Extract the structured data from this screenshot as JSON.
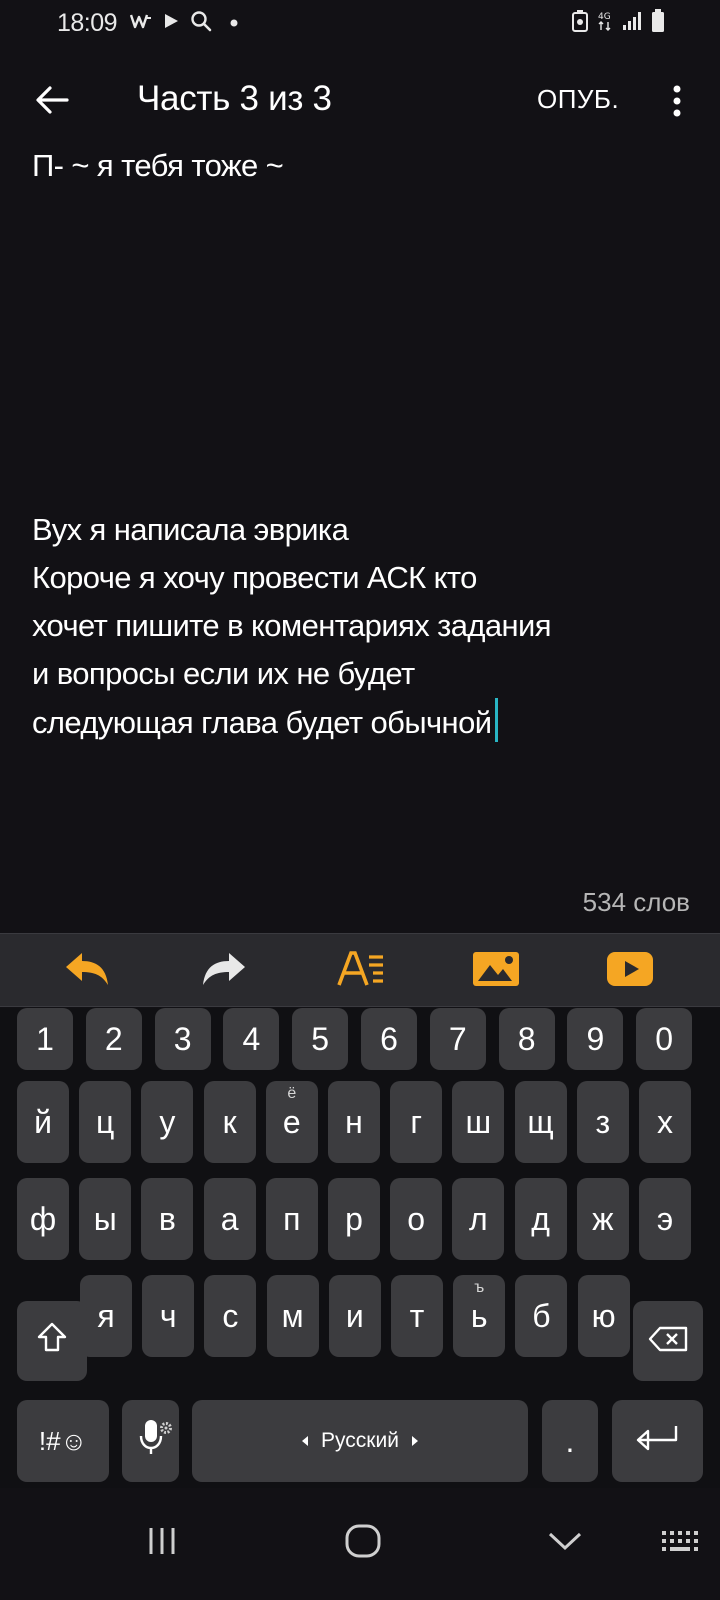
{
  "status_bar": {
    "time": "18:09",
    "left_icons": [
      "w-notification-icon",
      "play-icon",
      "search-icon",
      "dot-icon"
    ],
    "right_icons": [
      "battery-saver-icon",
      "4g-icon",
      "signal-icon",
      "battery-icon"
    ]
  },
  "app_bar": {
    "title": "Часть 3 из 3",
    "publish_label": "ОПУБ."
  },
  "editor": {
    "first_line": "П- ~ я тебя тоже ~",
    "body_lines": [
      "Вух я написала эврика",
      "Короче я хочу провести  АСК кто",
      "хочет пишите в коментариях задания",
      "и вопросы если их не будет",
      "следующая глава будет обычной"
    ],
    "word_count": "534 слов"
  },
  "toolbar": {
    "accent_color": "#f5a623",
    "items": [
      "undo-icon",
      "redo-icon",
      "text-format-icon",
      "image-icon",
      "video-icon"
    ]
  },
  "keyboard": {
    "number_row": [
      "1",
      "2",
      "3",
      "4",
      "5",
      "6",
      "7",
      "8",
      "9",
      "0"
    ],
    "row1": [
      "й",
      "ц",
      "у",
      "к",
      "е",
      "н",
      "г",
      "ш",
      "щ",
      "з",
      "х"
    ],
    "row1_alt": {
      "е": "ё"
    },
    "row2": [
      "ф",
      "ы",
      "в",
      "а",
      "п",
      "р",
      "о",
      "л",
      "д",
      "ж",
      "э"
    ],
    "row3": [
      "я",
      "ч",
      "с",
      "м",
      "и",
      "т",
      "ь",
      "б",
      "ю"
    ],
    "row3_alt": {
      "ь": "ъ"
    },
    "symbols_label": "!#☺",
    "space_label": "Русский",
    "period_label": "."
  }
}
